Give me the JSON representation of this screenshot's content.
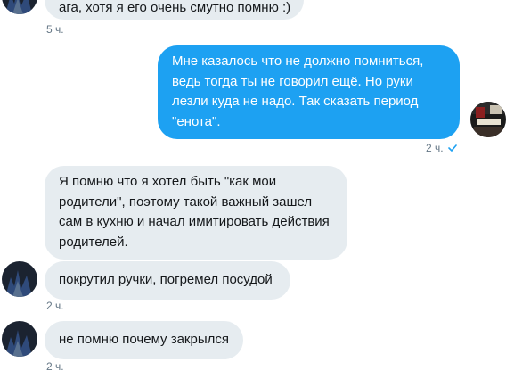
{
  "messages": [
    {
      "direction": "in",
      "lines": [
        "ага, хотя я его очень смутно помню :)"
      ],
      "time": "5 ч."
    },
    {
      "direction": "out",
      "lines": [
        "Мне казалось что не должно помниться,",
        "ведь тогда ты не говорил ещё. Но руки",
        "лезли куда не надо. Так сказать период",
        "\"енота\"."
      ],
      "time": "2 ч.",
      "status_icon": "checkmark-icon"
    },
    {
      "direction": "in",
      "lines": [
        "Я помню что я хотел быть \"как мои",
        "родители\", поэтому такой важный зашел",
        "сам в кухню и начал имитировать действия",
        "родителей."
      ]
    },
    {
      "direction": "in",
      "lines": [
        "покрутил ручки, погремел посудой"
      ],
      "time": "2 ч."
    },
    {
      "direction": "in",
      "lines": [
        "не помню почему закрылся"
      ],
      "time": "2 ч."
    }
  ],
  "colors": {
    "incoming_bubble": "#e6ecf0",
    "outgoing_bubble": "#1da1f2",
    "timestamp": "#657786",
    "read_check": "#1da1f2"
  }
}
